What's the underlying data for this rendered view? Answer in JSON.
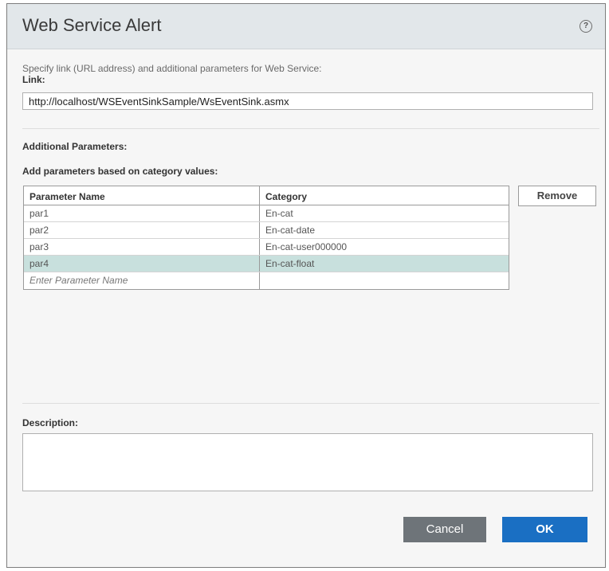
{
  "dialog": {
    "title": "Web Service Alert",
    "help_icon": "help-circle-icon",
    "help_glyph": "?"
  },
  "link_section": {
    "intro": "Specify link (URL address) and additional parameters for Web Service:",
    "label": "Link:",
    "value": "http://localhost/WSEventSinkSample/WsEventSink.asmx"
  },
  "params_section": {
    "title": "Additional Parameters:",
    "subtitle": "Add parameters based on category values:",
    "columns": [
      "Parameter Name",
      "Category"
    ],
    "rows": [
      {
        "name": "par1",
        "category": "En-cat"
      },
      {
        "name": "par2",
        "category": "En-cat-date"
      },
      {
        "name": "par3",
        "category": "En-cat-user000000"
      },
      {
        "name": "par4",
        "category": "En-cat-float"
      }
    ],
    "selected_row": "par4",
    "new_row_placeholder": "Enter Parameter Name",
    "remove_label": "Remove"
  },
  "description_section": {
    "label": "Description:",
    "value": ""
  },
  "footer": {
    "cancel_label": "Cancel",
    "ok_label": "OK"
  },
  "colors": {
    "titlebar_bg": "#e2e7ea",
    "selected_row_bg": "#c8e0dd",
    "cancel_bg": "#6e7479",
    "ok_bg": "#1a6fc3"
  }
}
